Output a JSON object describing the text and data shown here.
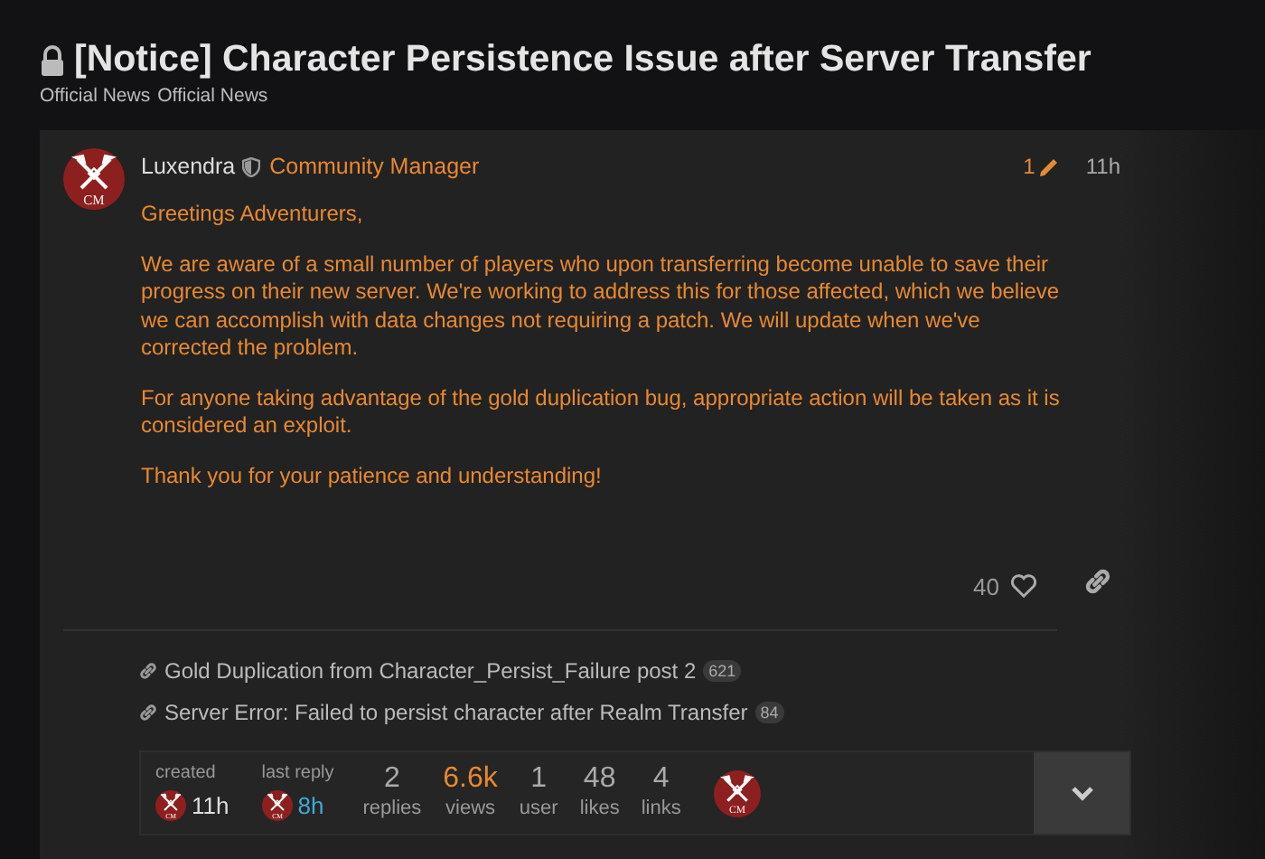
{
  "topic": {
    "title": "[Notice] Character Persistence Issue after Server Transfer",
    "locked": true,
    "categories": [
      "Official News",
      "Official News"
    ]
  },
  "post": {
    "avatar_text": "CM",
    "author": "Luxendra",
    "moderator": true,
    "title": "Community Manager",
    "edits": "1",
    "time": "11h",
    "paragraphs": [
      "Greetings Adventurers,",
      "We are aware of a small number of players who upon transferring become unable to save their progress on their new server. We're working to address this for those affected, which we believe we can accomplish with data changes not requiring a patch. We will update when we've corrected the problem.",
      "For anyone taking advantage of the gold duplication bug, appropriate action will be taken as it is considered an exploit.",
      "Thank you for your patience and understanding!"
    ],
    "likes": "40",
    "liked": false
  },
  "links": [
    {
      "title": "Gold Duplication from Character_Persist_Failure post 2",
      "clicks": "621"
    },
    {
      "title": "Server Error: Failed to persist character after Realm Transfer",
      "clicks": "84"
    }
  ],
  "topic_map": {
    "created": {
      "label": "created",
      "avatar_text": "CM",
      "time": "11h",
      "color": "#dddddd"
    },
    "last_reply": {
      "label": "last reply",
      "avatar_text": "CM",
      "time": "8h",
      "color": "#3fa9d8"
    },
    "stats": [
      {
        "value": "2",
        "label": "replies",
        "color": "#aaaaaa"
      },
      {
        "value": "6.6k",
        "label": "views",
        "color": "#e8892f"
      },
      {
        "value": "1",
        "label": "user",
        "color": "#aaaaaa"
      },
      {
        "value": "48",
        "label": "likes",
        "color": "#aaaaaa"
      },
      {
        "value": "4",
        "label": "links",
        "color": "#aaaaaa"
      }
    ],
    "participants": [
      {
        "avatar_text": "CM"
      }
    ],
    "expanded": false
  }
}
